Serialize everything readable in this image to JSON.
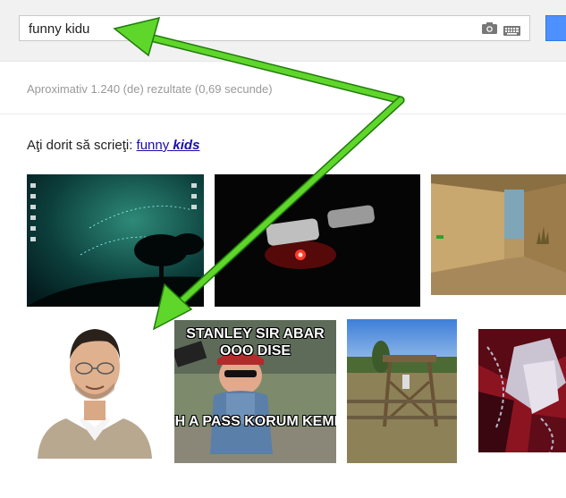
{
  "search": {
    "query": "funny kidu"
  },
  "results": {
    "stats": "Aproximativ 1.240 (de) rezultate (0,69 secunde)"
  },
  "spelling": {
    "prompt": "Aţi dorit să scrieţi:",
    "suggestion_plain": "funny",
    "suggestion_bold": "kids"
  },
  "images": {
    "row1": [
      {
        "name": "desktop-wallpaper-thumbnail"
      },
      {
        "name": "logo-intro-thumbnail"
      },
      {
        "name": "game-screenshot-thumbnail"
      }
    ],
    "row2": [
      {
        "name": "man-portrait-thumbnail"
      },
      {
        "name": "baby-meme-thumbnail",
        "caption_top": "STANLEY SIR ABAR OOO DISE",
        "caption_bottom": "TH A PASS KORUM KEMN"
      },
      {
        "name": "outdoor-structure-thumbnail"
      },
      {
        "name": "anime-art-thumbnail"
      }
    ]
  },
  "colors": {
    "arrow": "#5fd62a",
    "link": "#1a0dab",
    "search_button": "#4d90fe"
  }
}
